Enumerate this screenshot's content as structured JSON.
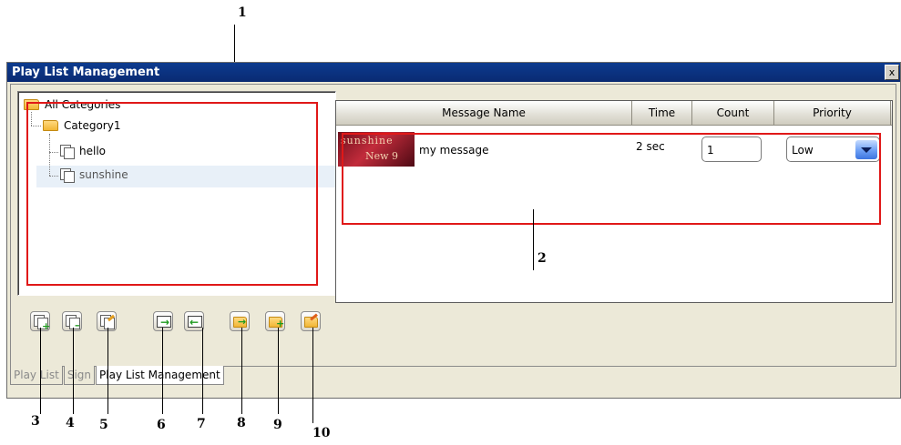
{
  "window": {
    "title": "Play List Management",
    "close_label": "x"
  },
  "tree": {
    "root": "All Categories",
    "category": "Category1",
    "items": [
      "hello",
      "sunshine"
    ],
    "selected": "sunshine"
  },
  "table": {
    "columns": [
      "Message Name",
      "Time",
      "Count",
      "Priority"
    ],
    "rows": [
      {
        "thumb_line1": "sunshine",
        "thumb_line2": "New 9",
        "name": "my message",
        "time": "2 sec",
        "count": "1",
        "priority": "Low"
      }
    ]
  },
  "toolbar": {
    "buttons": [
      "add-message",
      "remove-message",
      "edit-message",
      "import",
      "export",
      "open-playlist",
      "add-playlist",
      "edit-playlist"
    ]
  },
  "tabs": [
    "Play List",
    "Sign",
    "Play List Management"
  ],
  "active_tab": "Play List Management",
  "callouts": [
    "1",
    "2",
    "3",
    "4",
    "5",
    "6",
    "7",
    "8",
    "9",
    "10"
  ],
  "colors": {
    "title_bar": "#0a2f7e",
    "callout_box": "#e01818",
    "priority_arrow": "#4a82ea"
  }
}
